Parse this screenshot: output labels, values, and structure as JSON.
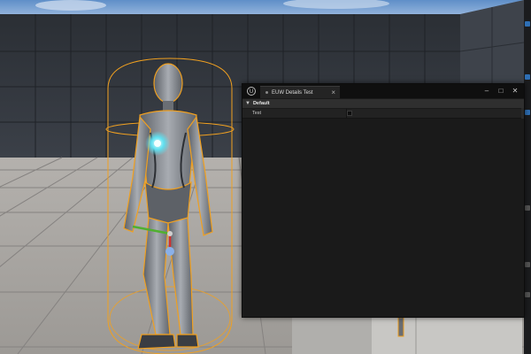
{
  "window": {
    "tab_label": "EUW Details Test",
    "tab_close": "×",
    "logo": "U",
    "btn_minimize": "–",
    "btn_maximize": "□",
    "btn_close": "✕"
  },
  "details": {
    "category": {
      "arrow": "▼",
      "label": "Default"
    },
    "properties": [
      {
        "name": "Test",
        "type": "boolean",
        "checked": false
      }
    ]
  },
  "colors": {
    "selection_outline": "#f0a020",
    "gizmo_x": "#d03030",
    "gizmo_y": "#50b030",
    "gizmo_z": "#3080e0",
    "window_bg": "#1a1a1a"
  },
  "icons": {
    "logo": "unreal-logo-icon",
    "minimize": "minimize-icon",
    "maximize": "maximize-icon",
    "close": "close-icon"
  }
}
